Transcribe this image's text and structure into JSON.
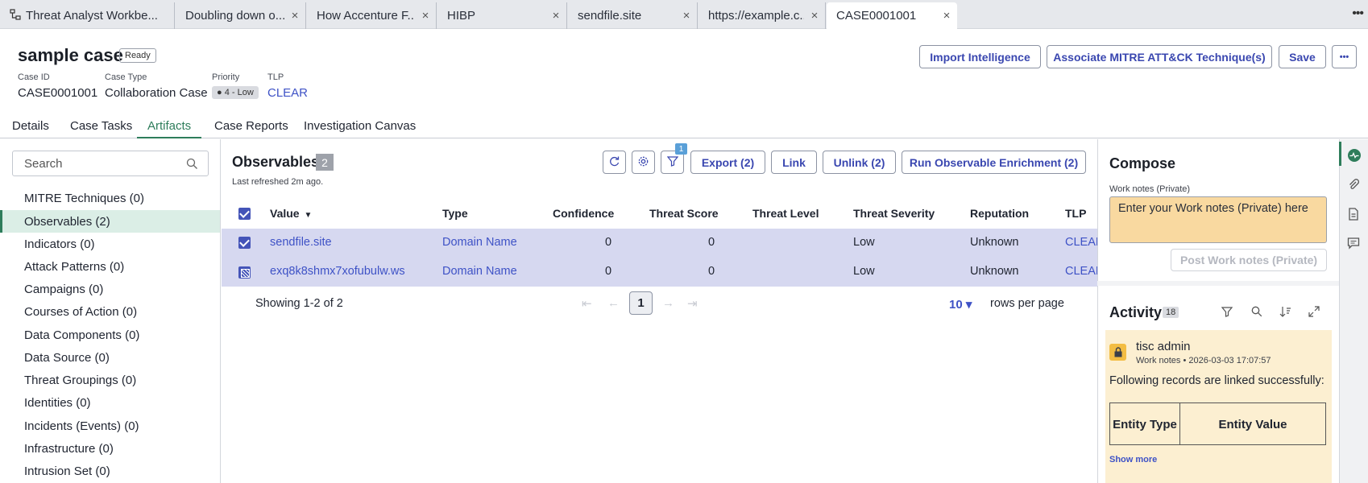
{
  "browser_tabs": [
    {
      "label": "Threat Analyst Workbe...",
      "icon": "workflow-icon"
    },
    {
      "label": "Doubling down o..."
    },
    {
      "label": "How Accenture F..."
    },
    {
      "label": "HIBP"
    },
    {
      "label": "sendfile.site"
    },
    {
      "label": "https://example.c..."
    },
    {
      "label": "CASE0001001"
    }
  ],
  "tab_close": "×",
  "tab_more": "•••",
  "case": {
    "title": "sample case",
    "status": "Ready",
    "case_id_label": "Case ID",
    "case_id": "CASE0001001",
    "case_type_label": "Case Type",
    "case_type": "Collaboration Case",
    "priority_label": "Priority",
    "priority": "● 4 - Low",
    "tlp_label": "TLP",
    "tlp": "CLEAR"
  },
  "header_actions": {
    "import": "Import Intelligence",
    "mitre": "Associate MITRE ATT&CK Technique(s)",
    "save": "Save",
    "more": "•••"
  },
  "case_tabs": [
    "Details",
    "Case Tasks",
    "Artifacts",
    "Case Reports",
    "Investigation Canvas"
  ],
  "left_nav": {
    "search_placeholder": "Search",
    "items": [
      "MITRE Techniques (0)",
      "Observables (2)",
      "Indicators (0)",
      "Attack Patterns (0)",
      "Campaigns (0)",
      "Courses of Action (0)",
      "Data Components (0)",
      "Data Source (0)",
      "Threat Groupings (0)",
      "Identities (0)",
      "Incidents (Events) (0)",
      "Infrastructure (0)",
      "Intrusion Set (0)"
    ]
  },
  "observables": {
    "title": "Observables",
    "count": "2",
    "last_refreshed": "Last refreshed 2m ago.",
    "filter_badge": "1",
    "buttons": {
      "export": "Export (2)",
      "link": "Link",
      "unlink": "Unlink (2)",
      "enrich": "Run Observable Enrichment (2)"
    },
    "columns": [
      "Value",
      "Type",
      "Confidence",
      "Threat Score",
      "Threat Level",
      "Threat Severity",
      "Reputation",
      "TLP"
    ],
    "sort_indicator": "▼",
    "rows": [
      {
        "value": "sendfile.site",
        "type": "Domain Name",
        "confidence": "0",
        "threat_score": "0",
        "threat_level": "",
        "threat_severity": "Low",
        "reputation": "Unknown",
        "tlp": "CLEAR"
      },
      {
        "value": "exq8k8shmx7xofubulw.ws",
        "type": "Domain Name",
        "confidence": "0",
        "threat_score": "0",
        "threat_level": "",
        "threat_severity": "Low",
        "reputation": "Unknown",
        "tlp": "CLEAR"
      }
    ],
    "showing": "Showing 1-2 of 2",
    "current_page": "1",
    "rows_per_page_value": "10 ▾",
    "rows_per_page_label": "rows per page"
  },
  "compose": {
    "title": "Compose",
    "work_notes_label": "Work notes (Private)",
    "work_notes_placeholder": "Enter your Work notes (Private) here",
    "post_button": "Post Work notes (Private)"
  },
  "activity": {
    "title": "Activity",
    "count": "18",
    "entry": {
      "user": "tisc admin",
      "meta": "Work notes • 2026-03-03 17:07:57",
      "message": "Following records are linked successfully:",
      "table_headers": [
        "Entity Type",
        "Entity Value"
      ]
    },
    "show_more": "Show more"
  },
  "colors": {
    "accent": "#3a47b0",
    "active_tab_green": "#2e7d5b",
    "selected_row": "#d6d8f0",
    "work_notes_bg": "#f9d9a0",
    "activity_card_bg": "#fcefd1"
  }
}
